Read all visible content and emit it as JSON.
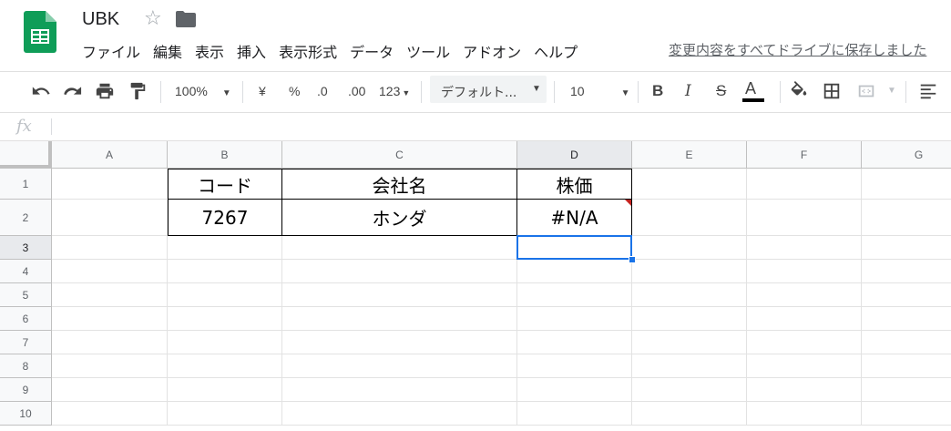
{
  "doc": {
    "title": "UBK"
  },
  "menu": [
    "ファイル",
    "編集",
    "表示",
    "挿入",
    "表示形式",
    "データ",
    "ツール",
    "アドオン",
    "ヘルプ"
  ],
  "save_status": "変更内容をすべてドライブに保存しました",
  "toolbar": {
    "zoom": "100%",
    "currency": "¥",
    "percent": "%",
    "dec_less": ".0",
    "dec_more": ".00",
    "more_formats": "123",
    "font": "デフォルト...",
    "font_size": "10",
    "bold": "B",
    "italic": "I",
    "strike": "S",
    "text_color": "A"
  },
  "formula": {
    "label": "fx",
    "value": ""
  },
  "columns": [
    "A",
    "B",
    "C",
    "D",
    "E",
    "F",
    "G"
  ],
  "rows": [
    "1",
    "2",
    "3",
    "4",
    "5",
    "6",
    "7",
    "8",
    "9",
    "10"
  ],
  "cells": {
    "B1": "コード",
    "C1": "会社名",
    "D1": "株価",
    "B2": "7267",
    "C2": "ホンダ",
    "D2": "#N/A"
  },
  "colors": {
    "selection": "#1a73e8",
    "error_marker": "#c5221f",
    "sheets_green": "#0f9d58"
  },
  "selected_cell": "D3"
}
